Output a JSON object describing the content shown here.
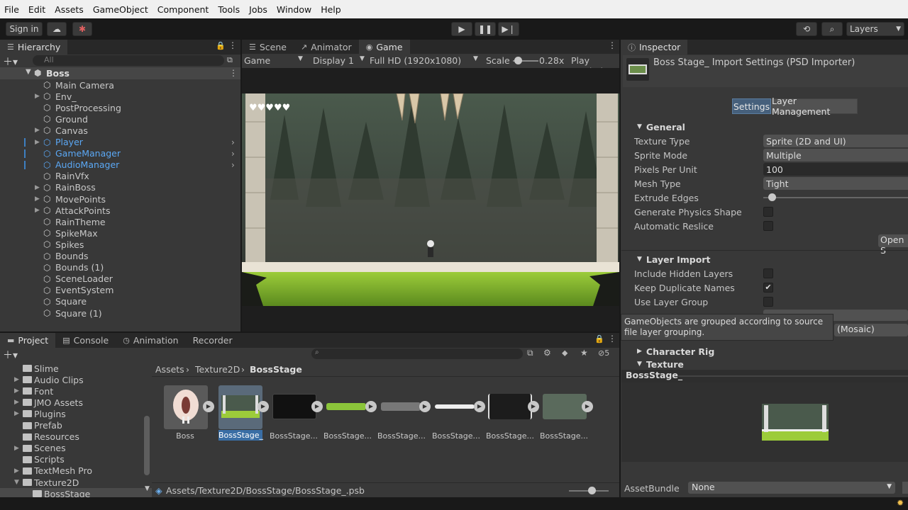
{
  "menu": [
    "File",
    "Edit",
    "Assets",
    "GameObject",
    "Component",
    "Tools",
    "Jobs",
    "Window",
    "Help"
  ],
  "toolbar": {
    "signin": "Sign in",
    "layers": "Layers"
  },
  "hierarchy": {
    "tab": "Hierarchy",
    "search_placeholder": "All",
    "scene": "Boss",
    "items": [
      {
        "label": "Main Camera",
        "expand": false,
        "blue": false
      },
      {
        "label": "Env_",
        "expand": true,
        "blue": false
      },
      {
        "label": "PostProcessing",
        "expand": false,
        "blue": false
      },
      {
        "label": "Ground",
        "expand": false,
        "blue": false
      },
      {
        "label": "Canvas",
        "expand": true,
        "blue": false
      },
      {
        "label": "Player",
        "expand": true,
        "blue": true
      },
      {
        "label": "GameManager",
        "expand": false,
        "blue": true
      },
      {
        "label": "AudioManager",
        "expand": false,
        "blue": true
      },
      {
        "label": "RainVfx",
        "expand": false,
        "blue": false
      },
      {
        "label": "RainBoss",
        "expand": true,
        "blue": false
      },
      {
        "label": "MovePoints",
        "expand": true,
        "blue": false
      },
      {
        "label": "AttackPoints",
        "expand": true,
        "blue": false
      },
      {
        "label": "RainTheme",
        "expand": false,
        "blue": false
      },
      {
        "label": "SpikeMax",
        "expand": false,
        "blue": false
      },
      {
        "label": "Spikes",
        "expand": false,
        "blue": false
      },
      {
        "label": "Bounds",
        "expand": false,
        "blue": false
      },
      {
        "label": "Bounds (1)",
        "expand": false,
        "blue": false
      },
      {
        "label": "SceneLoader",
        "expand": false,
        "blue": false
      },
      {
        "label": "EventSystem",
        "expand": false,
        "blue": false
      },
      {
        "label": "Square",
        "expand": false,
        "blue": false
      },
      {
        "label": "Square (1)",
        "expand": false,
        "blue": false
      }
    ]
  },
  "center_tabs": {
    "scene": "Scene",
    "animator": "Animator",
    "game": "Game"
  },
  "game_bar": {
    "mode": "Game",
    "display": "Display 1",
    "resolution": "Full HD (1920x1080)",
    "scale_label": "Scale",
    "scale_value": "0.28x",
    "play": "Play Maximi"
  },
  "inspector": {
    "tab": "Inspector",
    "title": "Boss Stage_ Import Settings (PSD Importer)",
    "btn_settings": "Settings",
    "btn_layer": "Layer Management",
    "general": "General",
    "texture_type_label": "Texture Type",
    "texture_type": "Sprite (2D and UI)",
    "sprite_mode_label": "Sprite Mode",
    "sprite_mode": "Multiple",
    "ppu_label": "Pixels Per Unit",
    "ppu": "100",
    "mesh_type_label": "Mesh Type",
    "mesh_type": "Tight",
    "extrude_label": "Extrude Edges",
    "gen_physics_label": "Generate Physics Shape",
    "auto_reslice_label": "Automatic Reslice",
    "open_btn": "Open S",
    "layer_import": "Layer Import",
    "include_hidden_label": "Include Hidden Layers",
    "keep_dup_label": "Keep Duplicate Names",
    "use_layer_group_label": "Use Layer Group",
    "tooltip": "GameObjects are grouped according to source file layer grouping.",
    "mosaic": "(Mosaic)",
    "character_rig": "Character Rig",
    "texture": "Texture",
    "preview_name": "BossStage_",
    "assetbundle_label": "AssetBundle",
    "assetbundle": "None"
  },
  "bottom_tabs": {
    "project": "Project",
    "console": "Console",
    "animation": "Animation",
    "recorder": "Recorder",
    "count": "5"
  },
  "project_tree": [
    {
      "label": "Slime",
      "indent": 0,
      "arrow": false
    },
    {
      "label": "Audio Clips",
      "indent": 0,
      "arrow": true
    },
    {
      "label": "Font",
      "indent": 0,
      "arrow": true
    },
    {
      "label": "JMO Assets",
      "indent": 0,
      "arrow": true
    },
    {
      "label": "Plugins",
      "indent": 0,
      "arrow": true
    },
    {
      "label": "Prefab",
      "indent": 0,
      "arrow": false
    },
    {
      "label": "Resources",
      "indent": 0,
      "arrow": false
    },
    {
      "label": "Scenes",
      "indent": 0,
      "arrow": true
    },
    {
      "label": "Scripts",
      "indent": 0,
      "arrow": false
    },
    {
      "label": "TextMesh Pro",
      "indent": 0,
      "arrow": true
    },
    {
      "label": "Texture2D",
      "indent": 0,
      "arrow": true
    },
    {
      "label": "BossStage",
      "indent": 1,
      "arrow": false
    }
  ],
  "breadcrumb": [
    "Assets",
    "Texture2D",
    "BossStage"
  ],
  "assets": [
    "Boss",
    "BossStage_",
    "BossStage...",
    "BossStage...",
    "BossStage...",
    "BossStage...",
    "BossStage...",
    "BossStage..."
  ],
  "status_path": "Assets/Texture2D/BossStage/BossStage_.psb"
}
